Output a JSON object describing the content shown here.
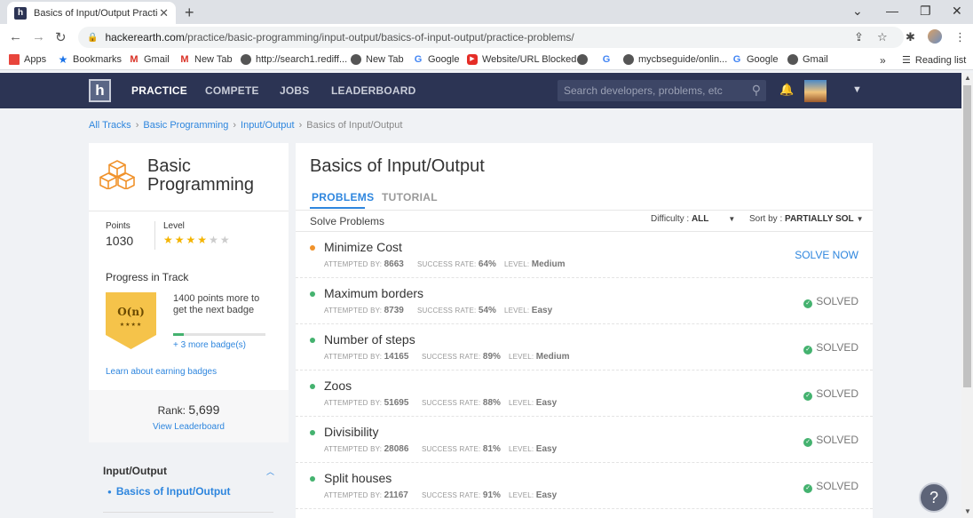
{
  "browser": {
    "tab_title": "Basics of Input/Output Practice P",
    "url_host": "hackerearth.com",
    "url_path": "/practice/basic-programming/input-output/basics-of-input-output/practice-problems/",
    "bookmarks": [
      "Apps",
      "Bookmarks",
      "Gmail",
      "New Tab",
      "http://search1.rediff...",
      "New Tab",
      "Google",
      "Website/URL Blocked",
      "",
      "",
      "mycbseguide/onlin...",
      "Google",
      "Gmail"
    ],
    "reading_list": "Reading list"
  },
  "site_nav": {
    "logo": "h",
    "items": [
      "PRACTICE",
      "COMPETE",
      "JOBS",
      "LEADERBOARD"
    ],
    "search_placeholder": "Search developers, problems, etc"
  },
  "breadcrumb": [
    "All Tracks",
    "Basic Programming",
    "Input/Output",
    "Basics of Input/Output"
  ],
  "track": {
    "title_line1": "Basic",
    "title_line2": "Programming",
    "points_label": "Points",
    "points": "1030",
    "level_label": "Level",
    "level_stars": 4,
    "level_max": 6,
    "progress_label": "Progress in Track",
    "badge_text": "O(n)",
    "badge_stars": "★★★★",
    "points_more": "1400 points more to get the next badge",
    "progress": 0.12,
    "more_badges": "+ 3 more badge(s)",
    "earn_link": "Learn about earning badges",
    "rank_label": "Rank:",
    "rank": "5,699",
    "leaderboard_link": "View Leaderboard",
    "topic": "Input/Output",
    "subtopic": "Basics of Input/Output"
  },
  "main": {
    "title": "Basics of Input/Output",
    "tabs": [
      "PROBLEMS",
      "TUTORIAL"
    ],
    "solve_label": "Solve Problems",
    "difficulty_label": "Difficulty :",
    "difficulty_value": "ALL",
    "sort_label": "Sort by :",
    "sort_value": "PARTIALLY SOL",
    "attempted_label": "ATTEMPTED BY:",
    "success_label": "SUCCESS RATE:",
    "level_label": "LEVEL:",
    "problems": [
      {
        "name": "Minimize Cost",
        "attempted": "8663",
        "success": "64%",
        "level": "Medium",
        "action": "SOLVE NOW",
        "solved": false,
        "dot": "#f0922b"
      },
      {
        "name": "Maximum borders",
        "attempted": "8739",
        "success": "54%",
        "level": "Easy",
        "action": "SOLVED",
        "solved": true,
        "dot": "#44b26f"
      },
      {
        "name": "Number of steps",
        "attempted": "14165",
        "success": "89%",
        "level": "Medium",
        "action": "SOLVED",
        "solved": true,
        "dot": "#44b26f"
      },
      {
        "name": "Zoos",
        "attempted": "51695",
        "success": "88%",
        "level": "Easy",
        "action": "SOLVED",
        "solved": true,
        "dot": "#44b26f"
      },
      {
        "name": "Divisibility",
        "attempted": "28086",
        "success": "81%",
        "level": "Easy",
        "action": "SOLVED",
        "solved": true,
        "dot": "#44b26f"
      },
      {
        "name": "Split houses",
        "attempted": "21167",
        "success": "91%",
        "level": "Easy",
        "action": "SOLVED",
        "solved": true,
        "dot": "#44b26f"
      }
    ]
  },
  "colors": {
    "header": "#2c3454",
    "accent": "#2e86de",
    "solved": "#44b26f",
    "badge": "#f5c34a"
  }
}
